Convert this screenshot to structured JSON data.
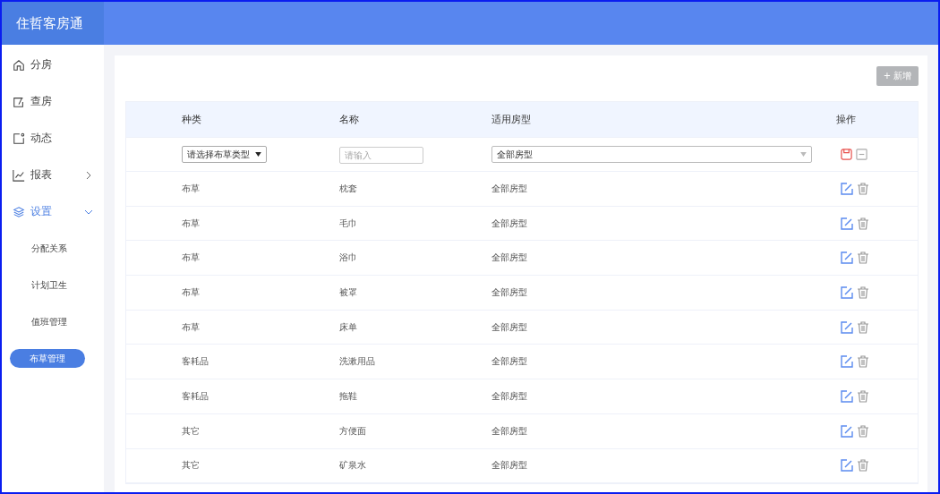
{
  "app": {
    "title": "住哲客房通"
  },
  "sidebar": {
    "items": [
      {
        "label": "分房",
        "selected": false
      },
      {
        "label": "查房",
        "selected": false
      },
      {
        "label": "动态",
        "selected": false
      },
      {
        "label": "报表",
        "selected": false,
        "expanded": false
      },
      {
        "label": "设置",
        "selected": true,
        "expanded": true,
        "children": [
          {
            "label": "分配关系",
            "selected": false
          },
          {
            "label": "计划卫生",
            "selected": false
          },
          {
            "label": "值班管理",
            "selected": false
          },
          {
            "label": "布草管理",
            "selected": true
          }
        ]
      }
    ]
  },
  "add_button": "+ 新增",
  "table": {
    "columns": [
      "种类",
      "名称",
      "适用房型",
      "操作"
    ],
    "new_row": {
      "type_select": "请选择布草类型",
      "name_placeholder": "请输入",
      "room_select": "全部房型"
    },
    "rows": [
      {
        "type": "布草",
        "name": "枕套",
        "room": "全部房型"
      },
      {
        "type": "布草",
        "name": "毛巾",
        "room": "全部房型"
      },
      {
        "type": "布草",
        "name": "浴巾",
        "room": "全部房型"
      },
      {
        "type": "布草",
        "name": "被罩",
        "room": "全部房型"
      },
      {
        "type": "布草",
        "name": "床单",
        "room": "全部房型"
      },
      {
        "type": "客耗品",
        "name": "洗漱用品",
        "room": "全部房型"
      },
      {
        "type": "客耗品",
        "name": "拖鞋",
        "room": "全部房型"
      },
      {
        "type": "其它",
        "name": "方便面",
        "room": "全部房型"
      },
      {
        "type": "其它",
        "name": "矿泉水",
        "room": "全部房型"
      }
    ]
  }
}
